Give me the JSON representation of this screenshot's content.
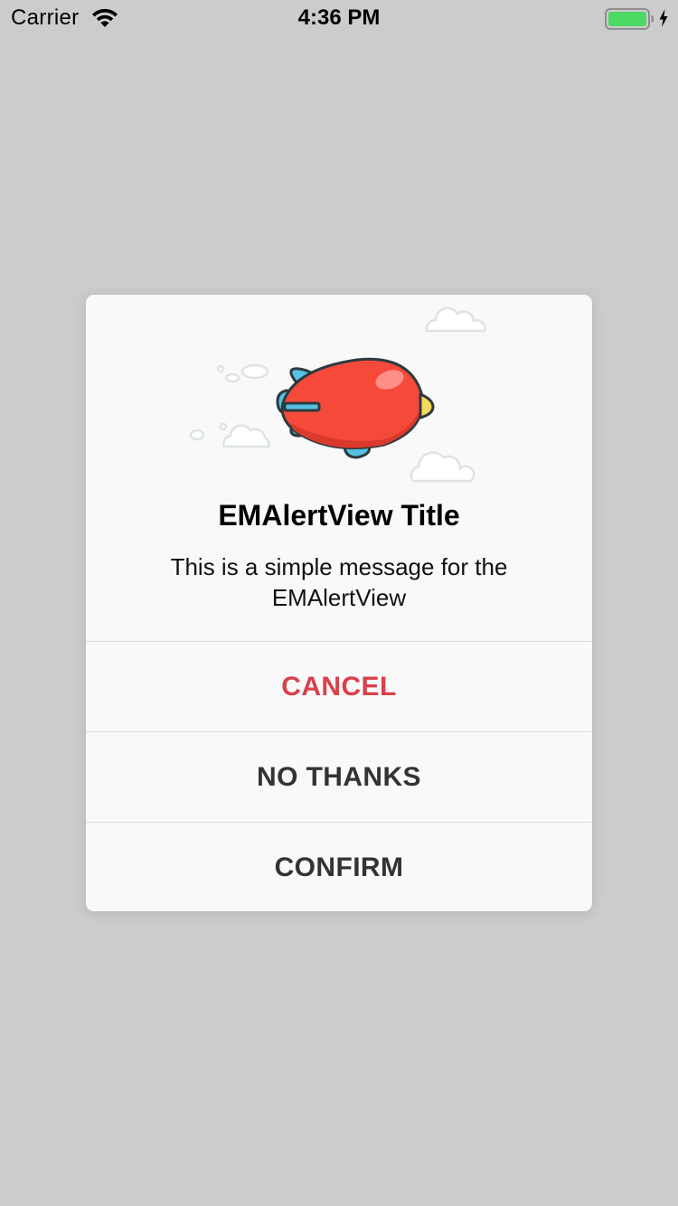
{
  "status_bar": {
    "carrier": "Carrier",
    "time": "4:36 PM",
    "battery_color": "#4cd964"
  },
  "alert": {
    "title": "EMAlertView Title",
    "message": "This is a simple message for the EMAlertView",
    "illustration": "blimp-illustration",
    "buttons": [
      {
        "label": "CANCEL",
        "color": "#d9414b"
      },
      {
        "label": "NO THANKS",
        "color": "#333333"
      },
      {
        "label": "CONFIRM",
        "color": "#333333"
      }
    ]
  }
}
